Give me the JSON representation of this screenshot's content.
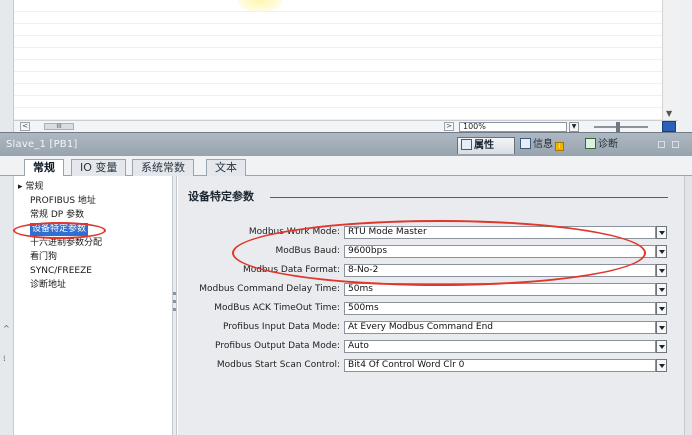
{
  "canvas": {
    "zoom_value": "100%",
    "hscroll_left": "<",
    "hscroll_right": ">",
    "hscroll_thumb": "III"
  },
  "inspector": {
    "title": "Slave_1 [PB1]",
    "tabs": {
      "properties": "属性",
      "info": "信息",
      "info_badge": "i",
      "diagnostics": "诊断"
    },
    "subtabs": [
      "常规",
      "IO 变量",
      "系统常数",
      "文本"
    ]
  },
  "tree": {
    "root": "常规",
    "items": [
      "PROFIBUS 地址",
      "常规 DP 参数",
      "设备特定参数",
      "十六进制参数分配",
      "看门狗",
      "SYNC/FREEZE",
      "诊断地址"
    ],
    "selected_index": 2
  },
  "section": {
    "title": "设备特定参数",
    "params": [
      {
        "label": "Modbus Work Mode:",
        "value": "RTU Mode Master"
      },
      {
        "label": "ModBus Baud:",
        "value": "9600bps"
      },
      {
        "label": "Modbus Data Format:",
        "value": "8-No-2"
      },
      {
        "label": "Modbus Command Delay Time:",
        "value": "50ms"
      },
      {
        "label": "ModBus ACK TimeOut Time:",
        "value": "500ms"
      },
      {
        "label": "Profibus Input Data Mode:",
        "value": "At Every Modbus Command End"
      },
      {
        "label": "Profibus Output Data Mode:",
        "value": "Auto"
      },
      {
        "label": "Modbus Start Scan Control:",
        "value": "Bit4 Of Control Word Clr 0"
      }
    ]
  },
  "colors": {
    "selection": "#2f6fd2",
    "annotation": "#e0362c"
  }
}
